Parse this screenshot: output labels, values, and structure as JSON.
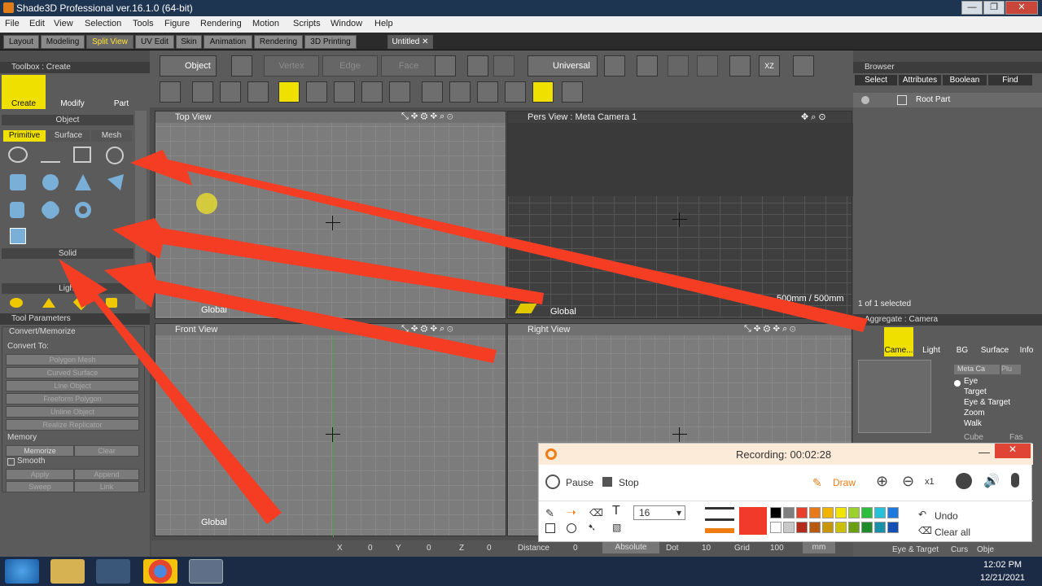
{
  "window": {
    "title": "Shade3D Professional ver.16.1.0 (64-bit)",
    "controls": [
      "—",
      "❐",
      "✕"
    ]
  },
  "menu": [
    "File",
    "Edit",
    "View",
    "Selection",
    "Tools",
    "Figure",
    "Rendering",
    "Motion",
    "Scripts",
    "Window",
    "Help"
  ],
  "tabs": [
    "Layout",
    "Modeling",
    "Split View",
    "UV Edit",
    "Skin",
    "Animation",
    "Rendering",
    "3D Printing"
  ],
  "tab_controls": "+ —",
  "doc_tab": "Untitled",
  "toolbar": {
    "object_label": "Object",
    "vertex": "Vertex",
    "edge": "Edge",
    "face": "Face",
    "universal": "Universal",
    "xz": "XZ"
  },
  "toolbox": {
    "header": "Toolbox : Create",
    "create": "Create",
    "modify": "Modify",
    "part": "Part",
    "object_section": "Object",
    "subtabs": [
      "Primitive",
      "Surface",
      "Mesh"
    ],
    "solid_section": "Solid",
    "light_section": "Light"
  },
  "tool_params": {
    "header": "Tool Parameters",
    "convert_memorize": "Convert/Memorize",
    "convert_to": "Convert To:",
    "convert_buttons": [
      "Polygon Mesh",
      "Curved Surface",
      "Line Object",
      "Freeform Polygon",
      "Unline Object",
      "Realize Replicator"
    ],
    "memory": "Memory",
    "memorize": "Memorize",
    "clear": "Clear",
    "smooth": "Smooth",
    "apply": "Apply",
    "append": "Append",
    "sweep": "Sweep",
    "link": "Link"
  },
  "viewports": {
    "top": {
      "label": "Top View",
      "footer": "Global"
    },
    "pers": {
      "label": "Pers View : Meta Camera 1",
      "footer": "Global",
      "scale": "500mm / 500mm"
    },
    "front": {
      "label": "Front View",
      "footer": "Global"
    },
    "right": {
      "label": "Right View"
    }
  },
  "statusbar": {
    "x": "X",
    "x_val": "0",
    "y": "Y",
    "y_val": "0",
    "z": "Z",
    "z_val": "0",
    "distance": "Distance",
    "distance_val": "0",
    "absolute": "Absolute",
    "dot": "Dot",
    "dot_val": "10",
    "grid": "Grid",
    "grid_val": "100",
    "unit": "mm"
  },
  "browser": {
    "header": "Browser",
    "tabs": [
      "Select",
      "Attributes",
      "Boolean",
      "Find"
    ],
    "root": "Root Part",
    "selected": "1 of 1 selected"
  },
  "aggregate": {
    "header": "Aggregate : Camera",
    "icons": [
      "Came...",
      "Light",
      "BG",
      "Surface",
      "Info"
    ],
    "meta_ca": "Meta Ca",
    "plus": "Plu",
    "options": [
      "Eye",
      "Target",
      "Eye & Target",
      "Zoom",
      "Walk"
    ],
    "cube": "Cube",
    "fas": "Fas",
    "bottom_tabs": [
      "Eye & Target",
      "Curs",
      "Obje"
    ]
  },
  "recorder": {
    "title": "Recording:  00:02:28",
    "pause": "Pause",
    "stop": "Stop",
    "draw": "Draw",
    "zoom": "x1",
    "font_size": "16",
    "undo": "Undo",
    "clear_all": "Clear all",
    "colors": [
      "#000000",
      "#7f7f7f",
      "#e8402c",
      "#e87a1c",
      "#f0b400",
      "#f2e600",
      "#9bd12a",
      "#2ebd3c",
      "#26c0d8",
      "#1f7ae0",
      "#ffffff",
      "#c8c8c8",
      "#b42a1c",
      "#b85a12",
      "#c89600",
      "#c8c000",
      "#6aa012",
      "#1e8c2a",
      "#1a90a8",
      "#1450b4"
    ],
    "current_color": "#f23a2a"
  },
  "taskbar": {
    "time": "12:02 PM",
    "date": "12/21/2021"
  },
  "colors": {
    "accent_yellow": "#f0e000",
    "arrow_red": "#f53d24",
    "recording_orange": "#f07d14"
  }
}
